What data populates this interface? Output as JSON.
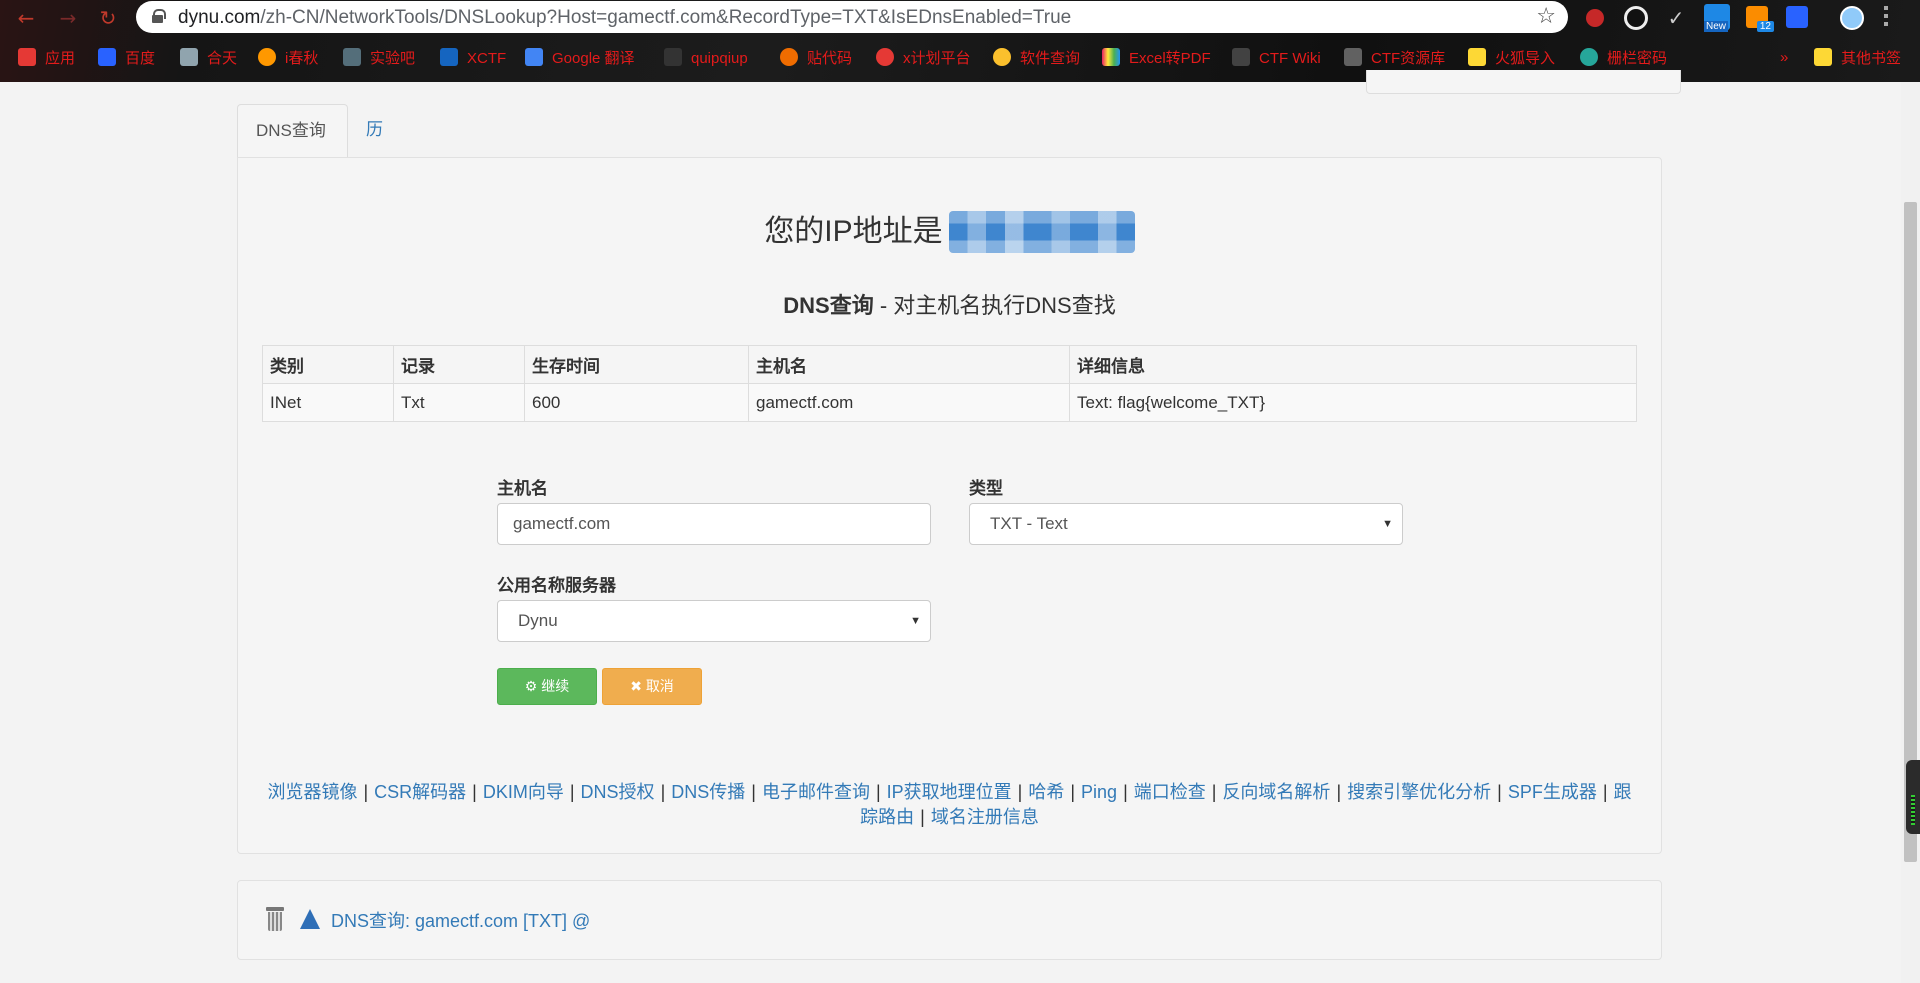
{
  "browser": {
    "url_domain": "dynu.com",
    "url_path": "/zh-CN/NetworkTools/DNSLookup?Host=gamectf.com&RecordType=TXT&IsEDnsEnabled=True",
    "ext_badge_new": "New",
    "ext_badge_count": "12",
    "bookmarks": [
      {
        "label": "应用",
        "color": "#e53935"
      },
      {
        "label": "百度",
        "color": "#2962ff"
      },
      {
        "label": "合天",
        "color": "#90a4ae"
      },
      {
        "label": "i春秋",
        "color": "#ff9800"
      },
      {
        "label": "实验吧",
        "color": "#546e7a"
      },
      {
        "label": "XCTF",
        "color": "#1565c0"
      },
      {
        "label": "Google 翻译",
        "color": "#4285f4"
      },
      {
        "label": "quipqiup",
        "color": "#333333"
      },
      {
        "label": "贴代码",
        "color": "#ef6c00"
      },
      {
        "label": "x计划平台",
        "color": "#e53935"
      },
      {
        "label": "软件查询",
        "color": "#fbc02d"
      },
      {
        "label": "Excel转PDF",
        "color": "#e91e63"
      },
      {
        "label": "CTF Wiki",
        "color": "#424242"
      },
      {
        "label": "CTF资源库",
        "color": "#616161"
      },
      {
        "label": "火狐导入",
        "color": "#fdd835"
      },
      {
        "label": "栅栏密码",
        "color": "#26a69a"
      },
      {
        "label": "其他书签",
        "color": "#fdd835"
      }
    ]
  },
  "tabs": {
    "dns_lookup": "DNS查询",
    "history": "历史查询记录"
  },
  "ip": {
    "prefix": "您的IP地址是"
  },
  "subtitle": {
    "strong": "DNS查询",
    "rest": " - 对主机名执行DNS查找"
  },
  "results": {
    "headers": [
      "类别",
      "记录",
      "生存时间",
      "主机名",
      "详细信息"
    ],
    "rows": [
      [
        "INet",
        "Txt",
        "600",
        "gamectf.com",
        "Text: flag{welcome_TXT}"
      ]
    ]
  },
  "form": {
    "hostname_label": "主机名",
    "hostname_value": "gamectf.com",
    "type_label": "类型",
    "type_value": "TXT - Text",
    "nameserver_label": "公用名称服务器",
    "nameserver_value": "Dynu",
    "continue_label": "继续",
    "cancel_label": "取消"
  },
  "footer_links": [
    "浏览器镜像",
    "CSR解码器",
    "DKIM向导",
    "DNS授权",
    "DNS传播",
    "电子邮件查询",
    "IP获取地理位置",
    "哈希",
    "Ping",
    "端口检查",
    "反向域名解析",
    "搜索引擎优化分析",
    "SPF生成器",
    "跟踪路由",
    "域名注册信息"
  ],
  "history_panel": {
    "link": "DNS查询: gamectf.com [TXT] @"
  },
  "colors": {
    "link": "#337ab7",
    "success": "#5cb85c",
    "warning": "#f0ad4e",
    "bookmark_text": "#e31b1b"
  }
}
